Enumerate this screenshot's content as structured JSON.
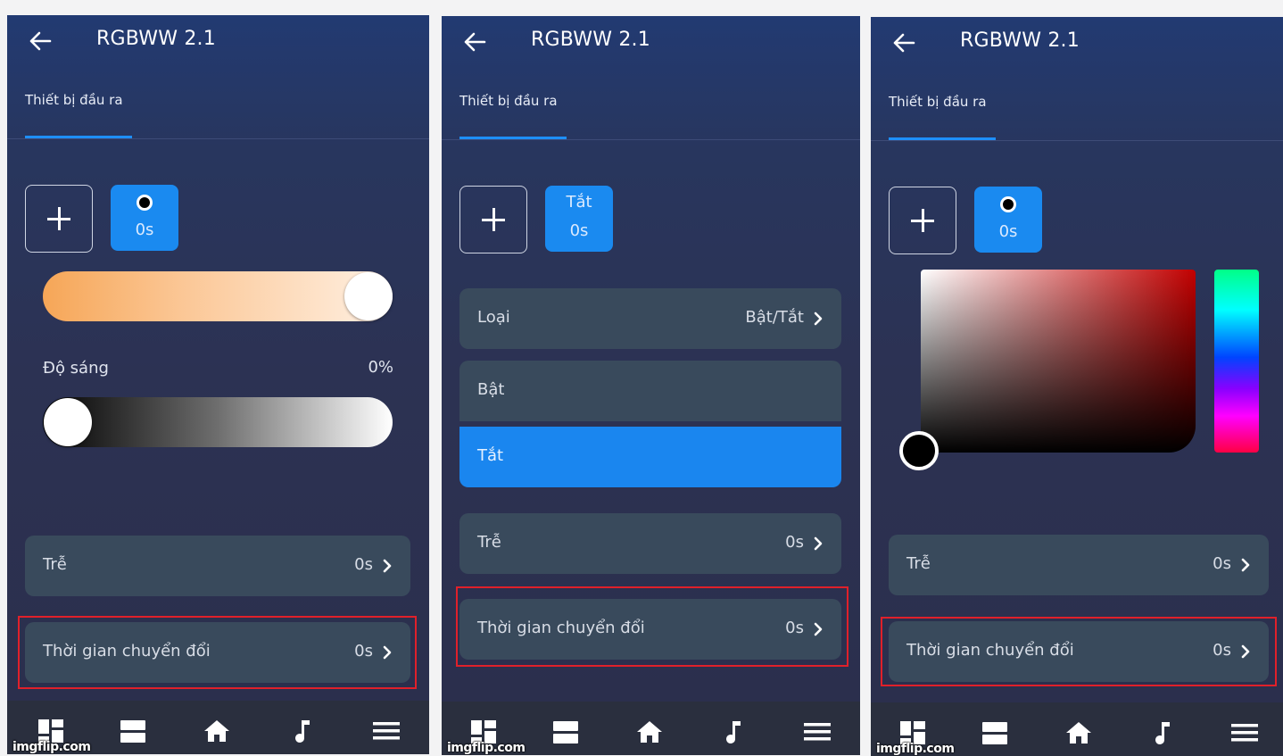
{
  "panels": [
    {
      "title": "RGBWW 2.1",
      "tab": "Thiết bị đầu ra",
      "scene": {
        "label": "",
        "time": "0s"
      },
      "brightness_label": "Độ sáng",
      "brightness_value": "0%",
      "rows": [
        {
          "label": "Trễ",
          "value": "0s"
        },
        {
          "label": "Thời gian chuyển đổi",
          "value": "0s"
        }
      ]
    },
    {
      "title": "RGBWW 2.1",
      "tab": "Thiết bị đầu ra",
      "scene": {
        "label": "Tắt",
        "time": "0s"
      },
      "type_row": {
        "label": "Loại",
        "value": "Bật/Tắt"
      },
      "options": [
        {
          "label": "Bật",
          "selected": false
        },
        {
          "label": "Tắt",
          "selected": true
        }
      ],
      "rows": [
        {
          "label": "Trễ",
          "value": "0s"
        },
        {
          "label": "Thời gian chuyển đổi",
          "value": "0s"
        }
      ]
    },
    {
      "title": "RGBWW 2.1",
      "tab": "Thiết bị đầu ra",
      "scene": {
        "label": "",
        "time": "0s"
      },
      "rows": [
        {
          "label": "Trễ",
          "value": "0s"
        },
        {
          "label": "Thời gian chuyển đổi",
          "value": "0s"
        }
      ]
    }
  ],
  "nav_icons": [
    "dashboard-icon",
    "list-icon",
    "home-icon",
    "music-icon",
    "menu-icon"
  ],
  "watermark": "imgflip.com",
  "colors": {
    "accent": "#1a8af0",
    "highlight": "#e0202a",
    "row_bg": "#394a5c",
    "nav_bg": "#2a2f3e"
  }
}
